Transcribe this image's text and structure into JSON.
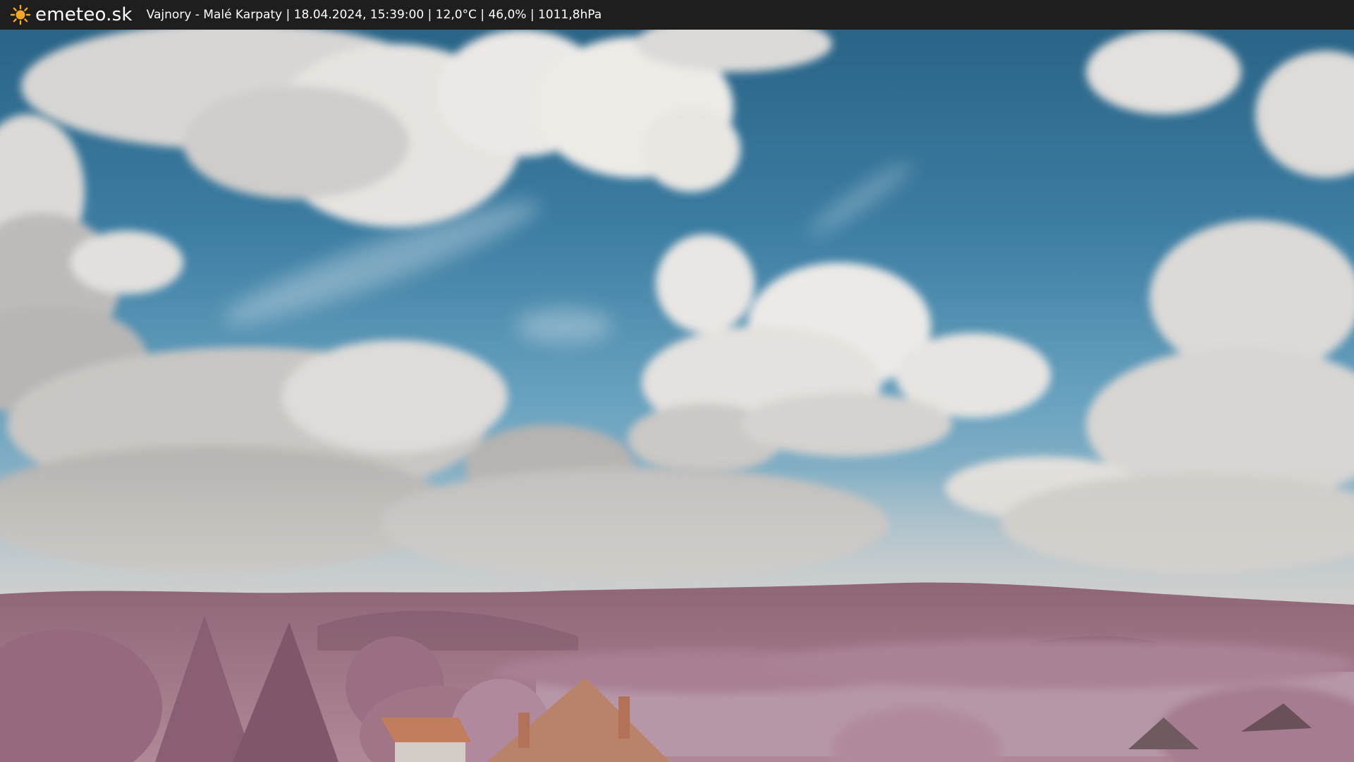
{
  "header": {
    "brand": "emeteo.sk",
    "brand_icon": "sun-icon",
    "caption": "Vajnory - Malé Karpaty | 18.04.2024, 15:39:00 | 12,0°C | 46,0% | 1011,8hPa"
  },
  "colors": {
    "topbar": "#1e1e1e",
    "sky_top": "#2f6c8e",
    "sky_mid": "#5293b4",
    "cloud": "#ece8e4",
    "hills": "#a0768a",
    "foliage": "#b4899c",
    "roof": "#b77a5e",
    "sun": "#f5a623"
  }
}
